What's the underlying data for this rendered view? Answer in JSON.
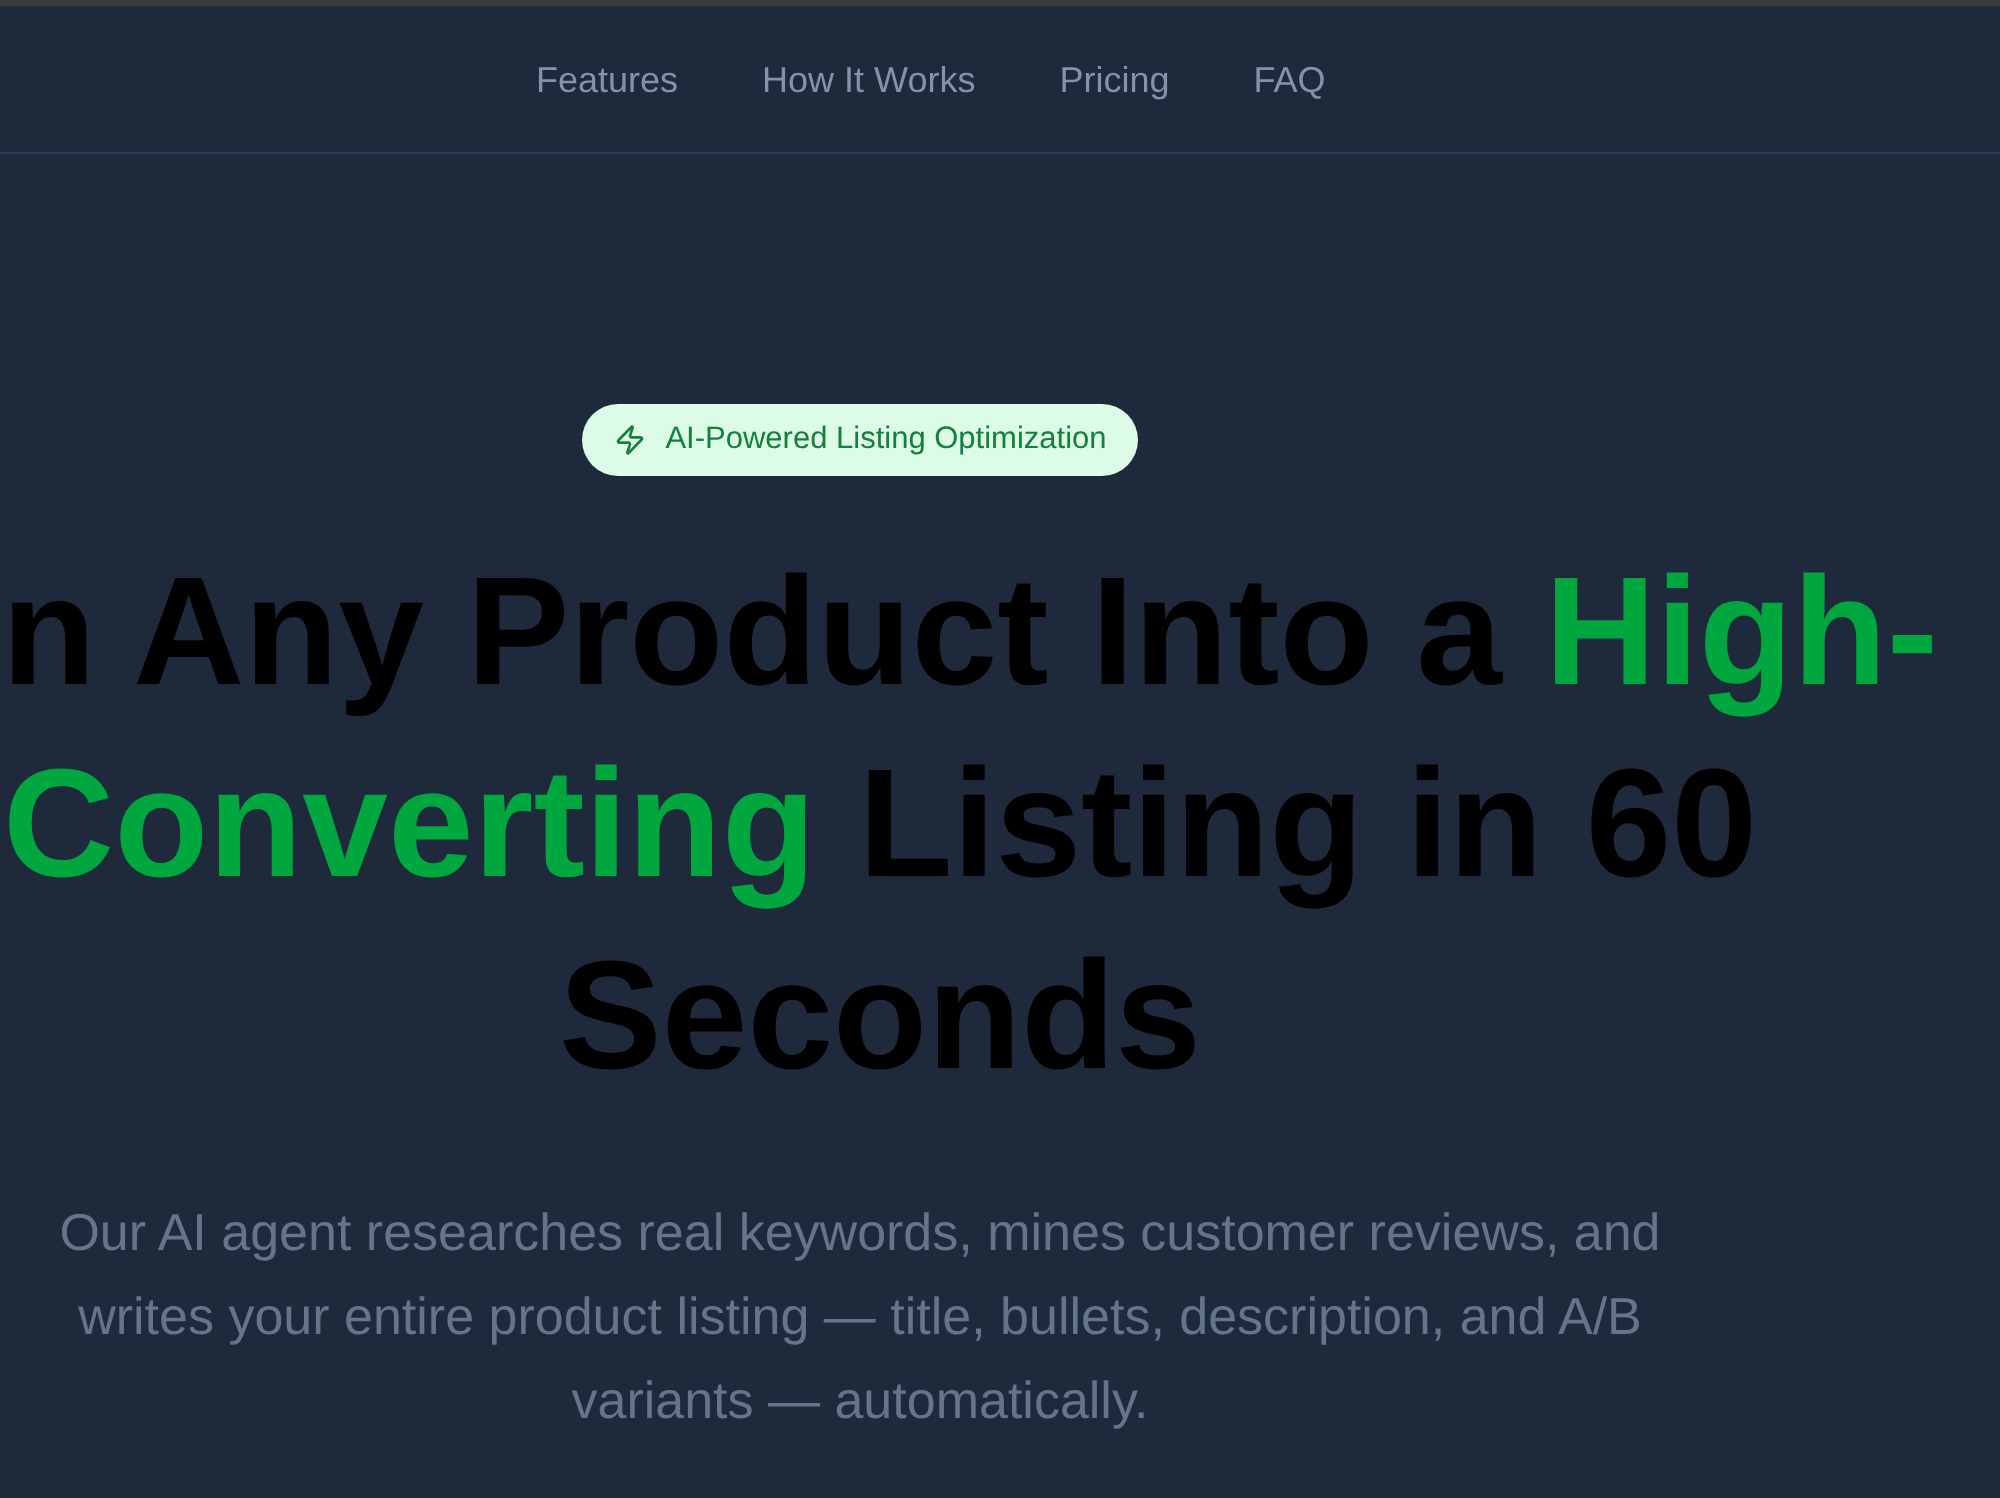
{
  "nav": {
    "links": [
      {
        "label": "Features"
      },
      {
        "label": "How It Works"
      },
      {
        "label": "Pricing"
      },
      {
        "label": "FAQ"
      }
    ]
  },
  "hero": {
    "badge": {
      "label": "AI-Powered Listing Optimization"
    },
    "heading": {
      "parts": [
        {
          "text": "n Any Product Into a ",
          "highlight": false
        },
        {
          "text": "High-Converting",
          "highlight": true
        },
        {
          "text": " Listing in 60 Seconds",
          "highlight": false
        }
      ]
    },
    "subtitle": "Our AI agent researches real keywords, mines customer reviews, and writes your entire product listing — title, bullets, description, and A/B variants — automatically."
  }
}
